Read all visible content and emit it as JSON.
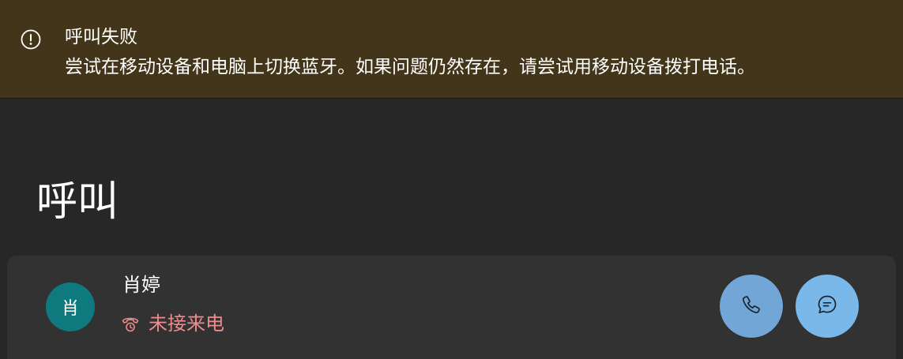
{
  "banner": {
    "icon": "info-circle-icon",
    "title": "呼叫失败",
    "message": "尝试在移动设备和电脑上切换蓝牙。如果问题仍然存在，请尝试用移动设备拨打电话。",
    "background_color": "#433519"
  },
  "page": {
    "title": "呼叫"
  },
  "call_entry": {
    "avatar_initial": "肖",
    "avatar_color": "#0e7a7e",
    "name": "肖婷",
    "status_icon": "missed-call-icon",
    "status": "未接来电",
    "status_color": "#ef8b8b",
    "actions": [
      {
        "icon": "phone-icon"
      },
      {
        "icon": "chat-icon"
      }
    ]
  }
}
